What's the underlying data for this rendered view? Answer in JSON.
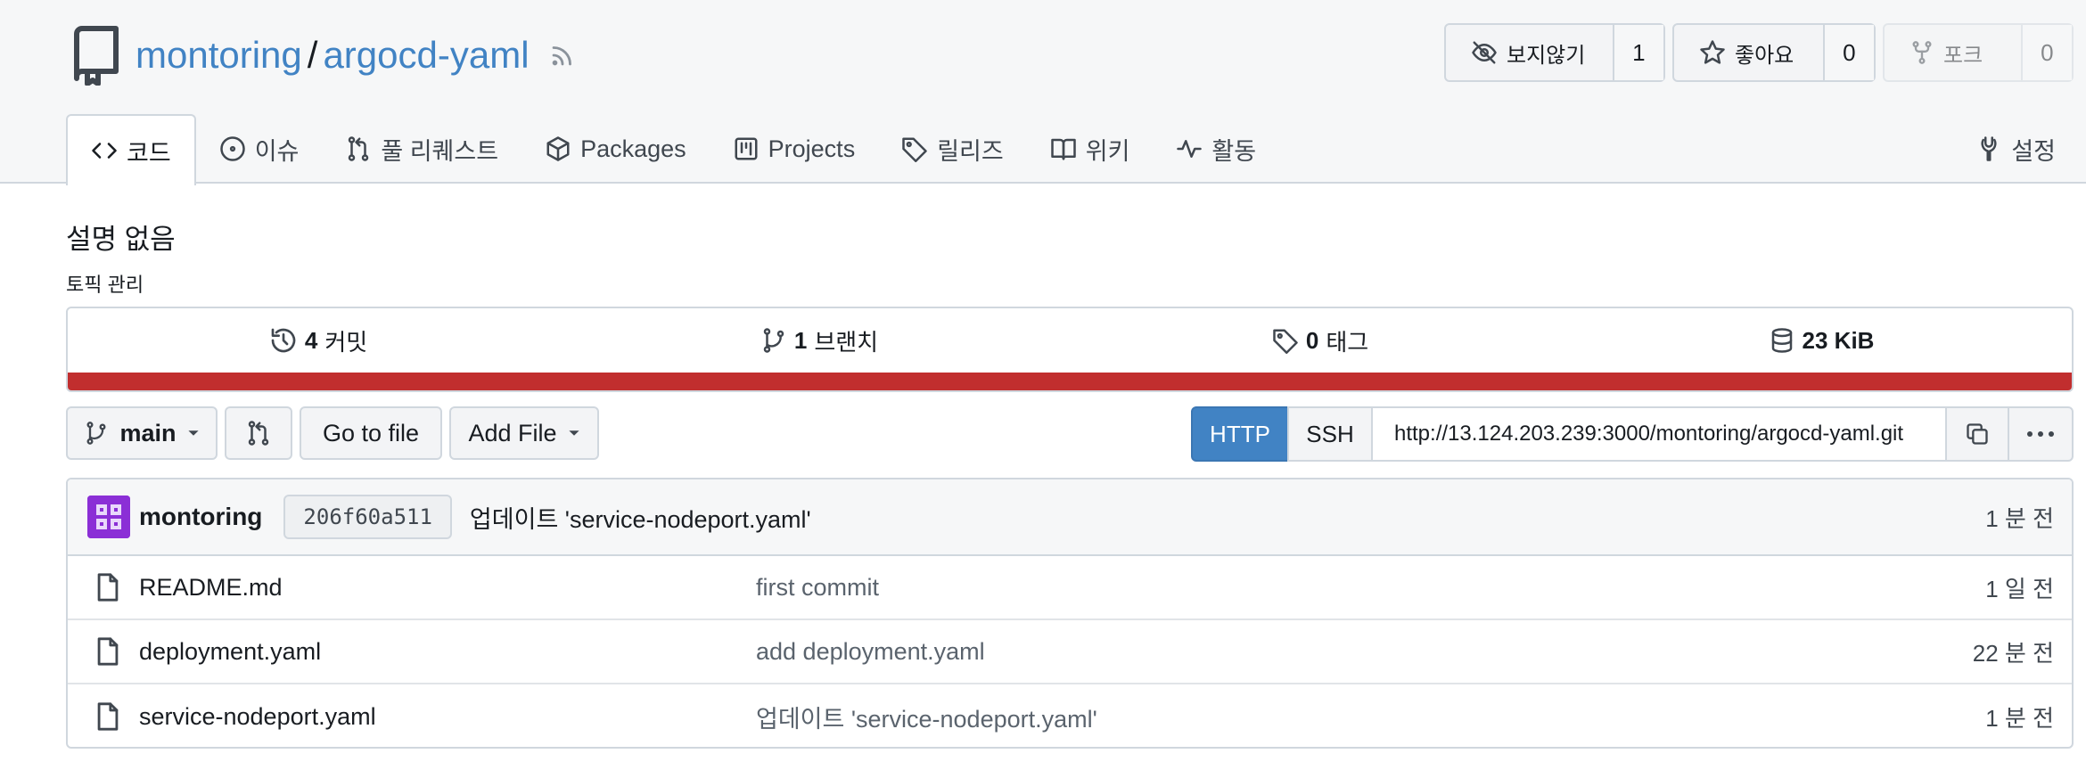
{
  "repo": {
    "owner": "montoring",
    "separator": "/",
    "name": "argocd-yaml"
  },
  "actions": {
    "watch": {
      "label": "보지않기",
      "count": "1"
    },
    "star": {
      "label": "좋아요",
      "count": "0"
    },
    "fork": {
      "label": "포크",
      "count": "0"
    }
  },
  "tabs": [
    {
      "label": "코드"
    },
    {
      "label": "이슈"
    },
    {
      "label": "풀 리퀘스트"
    },
    {
      "label": "Packages"
    },
    {
      "label": "Projects"
    },
    {
      "label": "릴리즈"
    },
    {
      "label": "위키"
    },
    {
      "label": "활동"
    }
  ],
  "settings_label": "설정",
  "description": "설명 없음",
  "topics_label": "토픽 관리",
  "stats": {
    "commits_num": "4",
    "commits_label": "커밋",
    "branches_num": "1",
    "branches_label": "브랜치",
    "tags_num": "0",
    "tags_label": "태그",
    "size": "23 KiB"
  },
  "colors": {
    "language_bar": "#c12e2e",
    "accent": "#4183c4"
  },
  "toolbar": {
    "branch": "main",
    "go_to_file": "Go to file",
    "add_file": "Add File"
  },
  "clone": {
    "http": "HTTP",
    "ssh": "SSH",
    "url": "http://13.124.203.239:3000/montoring/argocd-yaml.git"
  },
  "latest_commit": {
    "author": "montoring",
    "sha": "206f60a511",
    "message": "업데이트 'service-nodeport.yaml'",
    "time": "1 분 전"
  },
  "files": [
    {
      "name": "README.md",
      "commit": "first commit",
      "time": "1 일 전"
    },
    {
      "name": "deployment.yaml",
      "commit": "add deployment.yaml",
      "time": "22 분 전"
    },
    {
      "name": "service-nodeport.yaml",
      "commit": "업데이트 'service-nodeport.yaml'",
      "time": "1 분 전"
    }
  ]
}
